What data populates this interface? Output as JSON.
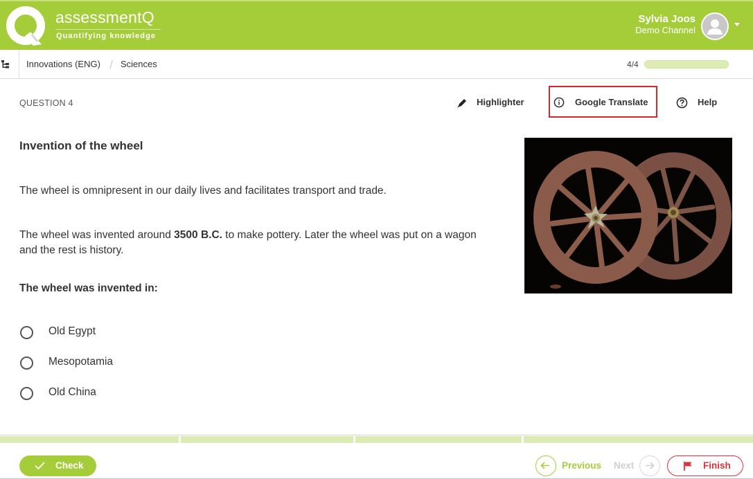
{
  "header": {
    "brand_name": "assessmentQ",
    "brand_tagline": "Quantifying knowledge",
    "user_name": "Sylvia Joos",
    "user_channel": "Demo Channel",
    "brand_color": "#a5cd39"
  },
  "breadcrumb": {
    "items": [
      "Innovations (ENG)",
      "Sciences"
    ],
    "separator": "/"
  },
  "progress": {
    "label": "4/4",
    "current": 4,
    "total": 4
  },
  "toolbar": {
    "question_label": "QUESTION 4",
    "highlighter_label": "Highlighter",
    "translate_label": "Google Translate",
    "help_label": "Help",
    "highlight_box_color": "#d8242f"
  },
  "question": {
    "title": "Invention of the wheel",
    "paragraph1": "The wheel is omnipresent in our daily lives and facilitates transport and trade.",
    "paragraph2_before": "The wheel was invented around ",
    "paragraph2_bold": "3500 B.C.",
    "paragraph2_after": " to make pottery. Later the wheel was put on a wagon and the rest is history.",
    "prompt": "The wheel was invented in:",
    "options": [
      {
        "label": "Old Egypt",
        "selected": false
      },
      {
        "label": "Mesopotamia",
        "selected": false
      },
      {
        "label": "Old China",
        "selected": false
      }
    ],
    "image_alt": "Two ancient rusted spoked wheels on black background"
  },
  "question_segments": {
    "count": 4
  },
  "footer": {
    "check_label": "Check",
    "previous_label": "Previous",
    "next_label": "Next",
    "finish_label": "Finish",
    "finish_color": "#e0313b"
  }
}
